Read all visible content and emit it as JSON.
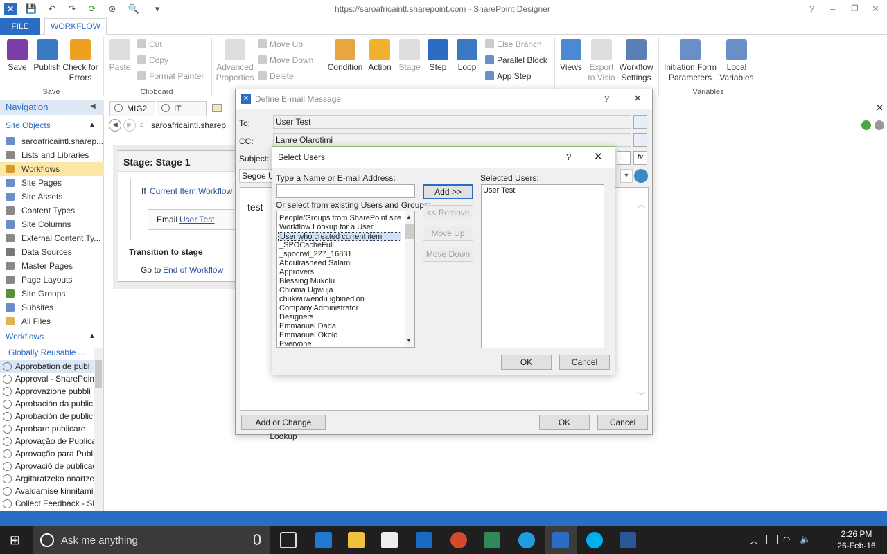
{
  "window": {
    "title": "https://saroafricaintl.sharepoint.com - SharePoint Designer",
    "controls": [
      "?",
      "–",
      "❐",
      "✕"
    ]
  },
  "ribbon": {
    "tabs": [
      {
        "label": "FILE"
      },
      {
        "label": "WORKFLOW"
      }
    ],
    "save_group": {
      "label": "Save",
      "save": "Save",
      "publish": "Publish",
      "check": "Check for Errors"
    },
    "clipboard": {
      "label": "Clipboard",
      "paste": "Paste",
      "cut": "Cut",
      "copy": "Copy",
      "format_painter": "Format Painter"
    },
    "modify": {
      "advanced": "Advanced Properties",
      "move_up": "Move Up",
      "move_down": "Move Down",
      "delete": "Delete"
    },
    "insert": {
      "condition": "Condition",
      "action": "Action",
      "stage": "Stage",
      "step": "Step",
      "loop": "Loop",
      "else_branch": "Else Branch",
      "parallel_block": "Parallel Block",
      "app_step": "App Step"
    },
    "manage": {
      "views": "Views",
      "export": "Export to Visio",
      "settings": "Workflow Settings"
    },
    "variables": {
      "label": "Variables",
      "init_form": "Initiation Form Parameters",
      "local_vars": "Local Variables"
    }
  },
  "navigation": {
    "header": "Navigation",
    "site_objects_label": "Site Objects",
    "site_objects": [
      {
        "label": "saroafricaintl.sharep...",
        "icon": "site-icon",
        "color": "#6a8fc7"
      },
      {
        "label": "Lists and Libraries",
        "icon": "list-icon",
        "color": "#888888"
      },
      {
        "label": "Workflows",
        "icon": "workflow-icon",
        "color": "#d89b2b"
      },
      {
        "label": "Site Pages",
        "icon": "page-icon",
        "color": "#6a8fc7"
      },
      {
        "label": "Site Assets",
        "icon": "assets-icon",
        "color": "#6a8fc7"
      },
      {
        "label": "Content Types",
        "icon": "content-types-icon",
        "color": "#888888"
      },
      {
        "label": "Site Columns",
        "icon": "columns-icon",
        "color": "#6a8fc7"
      },
      {
        "label": "External Content Ty...",
        "icon": "external-icon",
        "color": "#888888"
      },
      {
        "label": "Data Sources",
        "icon": "database-icon",
        "color": "#777777"
      },
      {
        "label": "Master Pages",
        "icon": "master-page-icon",
        "color": "#888888"
      },
      {
        "label": "Page Layouts",
        "icon": "layout-icon",
        "color": "#888888"
      },
      {
        "label": "Site Groups",
        "icon": "group-icon",
        "color": "#5a8f3c"
      },
      {
        "label": "Subsites",
        "icon": "subsite-icon",
        "color": "#6a8fc7"
      },
      {
        "label": "All Files",
        "icon": "folder-icon",
        "color": "#e0b44c"
      }
    ],
    "workflows_label": "Workflows",
    "globally_reusable": "Globally Reusable ...",
    "workflow_items": [
      "Approbation de publ",
      "Approval - SharePoint",
      "Approvazione pubbli",
      "Aprobación da public",
      "Aprobación de public",
      "Aprobare publicare",
      "Aprovação de Publica",
      "Aprovação para Publi",
      "Aprovació de publicac",
      "Argitaratzeko onartze",
      "Avaldamise kinnitamin",
      "Collect Feedback - Sh"
    ]
  },
  "doc": {
    "tabs": [
      "MIG2",
      "IT ticket"
    ],
    "address": "saroafricaintl.sharep",
    "stage_title": "Stage: Stage 1",
    "if_label": "If",
    "condition_link": "Current Item:Workflow",
    "email_label": "Email",
    "email_link": "User Test",
    "transition_label": "Transition to stage",
    "goto_label": "Go to",
    "goto_link": "End of Workflow"
  },
  "email_dialog": {
    "title": "Define E-mail Message",
    "to_label": "To:",
    "to_value": "User Test",
    "cc_label": "CC:",
    "cc_value": "Lanre Olarotimi",
    "subject_label": "Subject:",
    "ellipsis": "...",
    "fx": "fx",
    "font": "Segoe UI",
    "body": "test",
    "add_lookup": "Add or Change Lookup",
    "ok": "OK",
    "cancel": "Cancel"
  },
  "select_users": {
    "title": "Select Users",
    "name_label": "Type a Name or E-mail Address:",
    "name_value": "",
    "existing_label": "Or select from existing Users and Groups:",
    "items": [
      "People/Groups from SharePoint site...",
      "Workflow Lookup for a User...",
      "User who created current item",
      "_SPOCacheFull",
      "_spocrwl_227_16831",
      "Abdulrasheed Salami",
      "Approvers",
      "Blessing Mukolu",
      "Chioma Ugwuja",
      "chukwuwendu igbinedion",
      "Company Administrator",
      "Designers",
      "Emmanuel Dada",
      "Emmanuel Okolo",
      "Everyone"
    ],
    "selected_index": 2,
    "add": "Add >>",
    "remove": "<< Remove",
    "move_up": "Move Up",
    "move_down": "Move Down",
    "selected_label": "Selected Users:",
    "selected_users": [
      "User Test"
    ],
    "ok": "OK",
    "cancel": "Cancel"
  },
  "taskbar": {
    "search": "Ask me anything",
    "time": "2:26 PM",
    "date": "26-Feb-16"
  },
  "colors": {
    "accent": "#2b6cc4",
    "selected_nav": "#fce7a7",
    "taskbar": "#1f1f1f"
  }
}
